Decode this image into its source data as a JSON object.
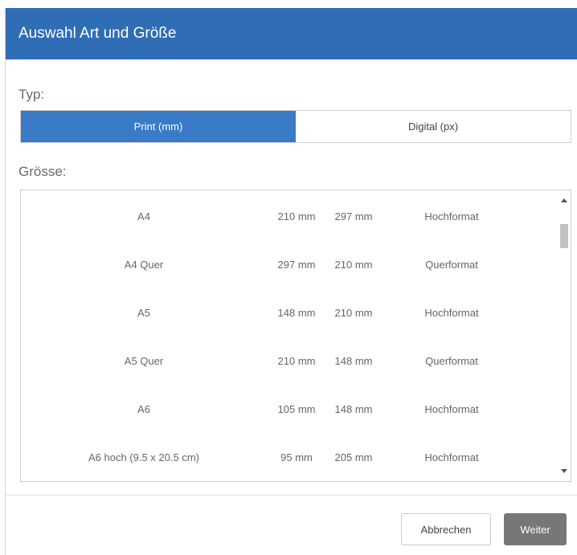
{
  "dialog": {
    "title": "Auswahl Art und Größe"
  },
  "type_section": {
    "label": "Typ:",
    "options": [
      {
        "label": "Print (mm)",
        "selected": true
      },
      {
        "label": "Digital (px)",
        "selected": false
      }
    ]
  },
  "size_section": {
    "label": "Grösse:",
    "rows": [
      {
        "name": "A4",
        "width": "210 mm",
        "height": "297 mm",
        "orientation": "Hochformat"
      },
      {
        "name": "A4 Quer",
        "width": "297 mm",
        "height": "210 mm",
        "orientation": "Querformat"
      },
      {
        "name": "A5",
        "width": "148 mm",
        "height": "210 mm",
        "orientation": "Hochformat"
      },
      {
        "name": "A5 Quer",
        "width": "210 mm",
        "height": "148 mm",
        "orientation": "Querformat"
      },
      {
        "name": "A6",
        "width": "105 mm",
        "height": "148 mm",
        "orientation": "Hochformat"
      },
      {
        "name": "A6 hoch (9.5 x 20.5 cm)",
        "width": "95 mm",
        "height": "205 mm",
        "orientation": "Hochformat"
      }
    ]
  },
  "footer": {
    "cancel_label": "Abbrechen",
    "next_label": "Weiter"
  },
  "colors": {
    "header": "#2f6db4",
    "toggle_active": "#3a7bc7",
    "next_button": "#777777"
  }
}
